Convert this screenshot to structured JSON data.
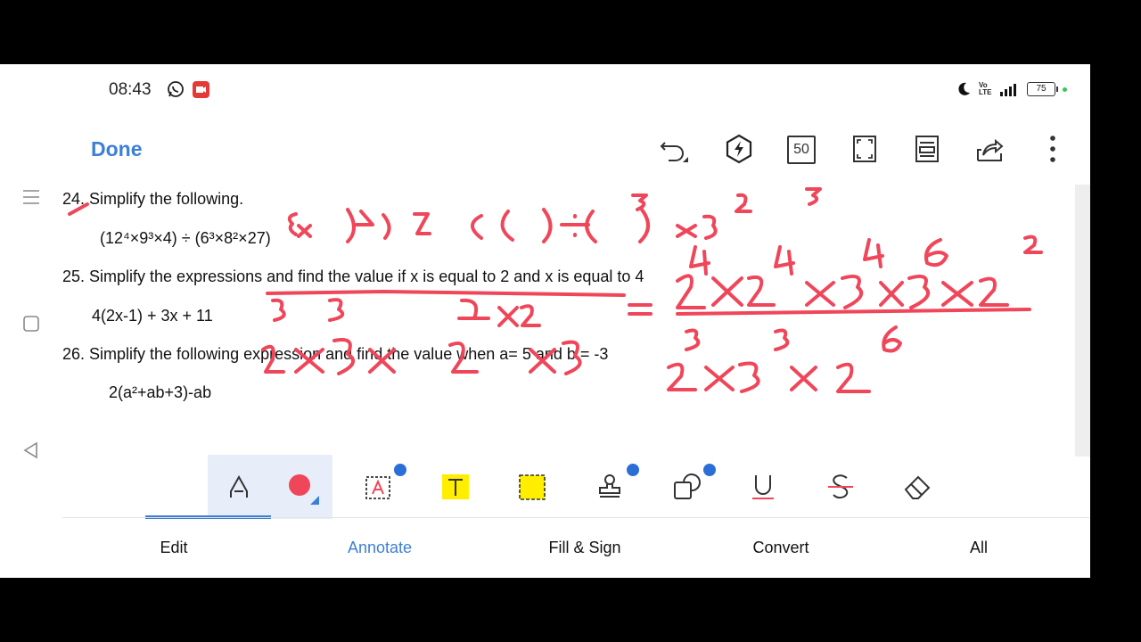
{
  "status_bar": {
    "time": "08:43",
    "battery": "75",
    "network": "4G",
    "volte": "Vo LTE"
  },
  "toolbar": {
    "done_label": "Done",
    "zoom_label": "50"
  },
  "document": {
    "lines": [
      "24. Simplify the following.",
      "(12⁴×9³×4) ÷ (6³×8²×27)",
      "25. Simplify the expressions and find the value if x is equal to 2 and x is equal to 4",
      "4(2x-1) + 3x + 11",
      "26. Simplify the following expression and find the value when a= 5 and b = -3",
      "2(a²+ab+3)-ab"
    ]
  },
  "annotation_tools": [
    {
      "name": "pen-tool",
      "icon": "pen-icon"
    },
    {
      "name": "color-picker",
      "icon": "red-dot-icon",
      "color": "#f0465a"
    },
    {
      "name": "text-box-tool",
      "icon": "text-box-icon",
      "badge": true
    },
    {
      "name": "highlight-text-tool",
      "icon": "highlight-icon",
      "color": "#ffee00"
    },
    {
      "name": "area-highlight-tool",
      "icon": "area-highlight-icon",
      "color": "#ffee00"
    },
    {
      "name": "stamp-tool",
      "icon": "stamp-icon",
      "badge": true
    },
    {
      "name": "shapes-tool",
      "icon": "shapes-icon",
      "badge": true
    },
    {
      "name": "underline-tool",
      "icon": "underline-icon"
    },
    {
      "name": "strikethrough-tool",
      "icon": "strikethrough-icon"
    },
    {
      "name": "eraser-tool",
      "icon": "eraser-icon"
    }
  ],
  "tabs": {
    "edit": "Edit",
    "annotate": "Annotate",
    "fill_sign": "Fill & Sign",
    "convert": "Convert",
    "all": "All"
  },
  "colors": {
    "accent": "#3d7fd6",
    "ink": "#f0465a",
    "highlight": "#ffee00"
  }
}
